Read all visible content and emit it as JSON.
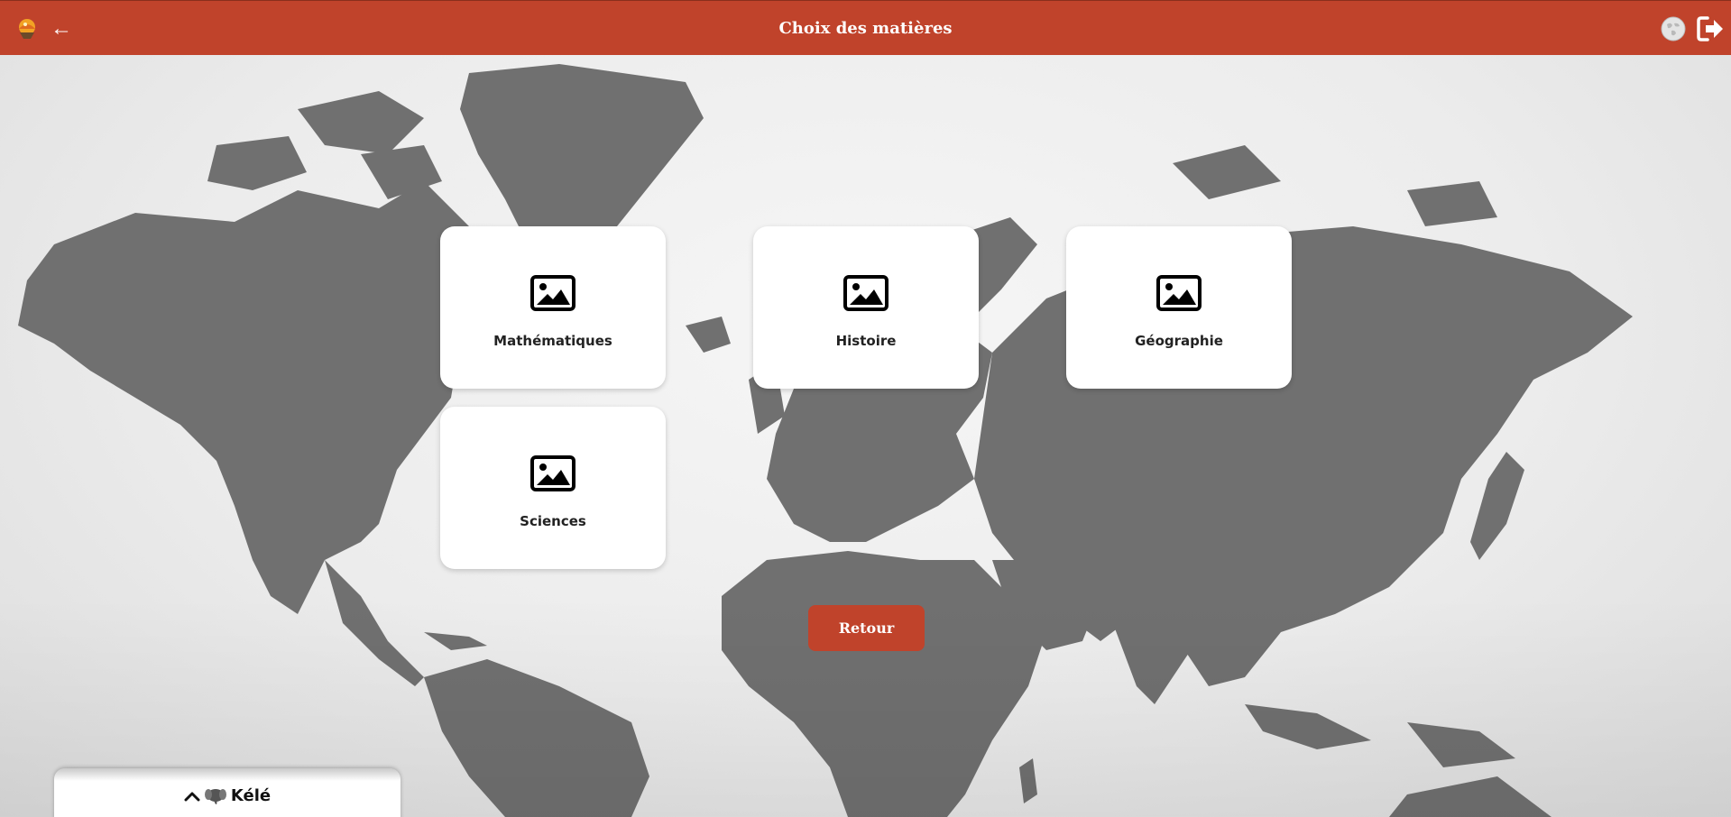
{
  "header": {
    "title": "Choix des matières",
    "back_label": "←"
  },
  "subjects": [
    {
      "label": "Mathématiques",
      "icon": "image-icon"
    },
    {
      "label": "Histoire",
      "icon": "image-icon"
    },
    {
      "label": "Géographie",
      "icon": "image-icon"
    },
    {
      "label": "Sciences",
      "icon": "image-icon"
    }
  ],
  "retour_button": {
    "label": "Retour"
  },
  "bottom_panel": {
    "name": "Kélé",
    "icons": [
      "chevron-up-icon",
      "elephant-icon"
    ]
  },
  "colors": {
    "accent": "#c0432b",
    "card": "#ffffff",
    "map": "#6f6f6f"
  },
  "icons": [
    "app-logo-icon",
    "back-arrow-icon",
    "globe-icon",
    "logout-icon"
  ]
}
